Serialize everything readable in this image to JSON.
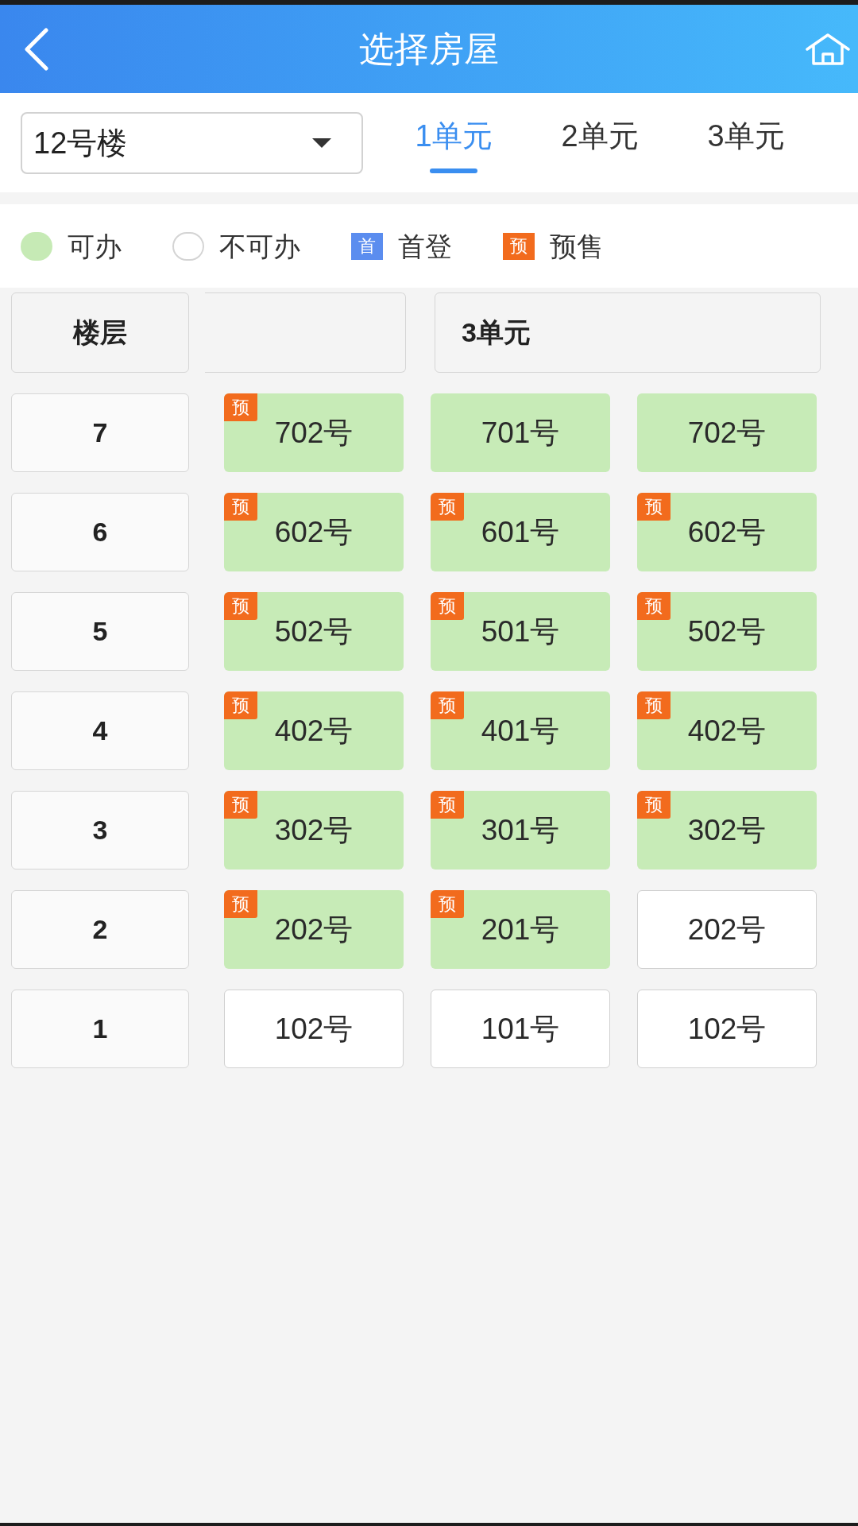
{
  "header": {
    "title": "选择房屋"
  },
  "building_select": {
    "value": "12号楼"
  },
  "unit_tabs": [
    {
      "label": "1单元",
      "selected": true
    },
    {
      "label": "2单元",
      "selected": false
    },
    {
      "label": "3单元",
      "selected": false
    }
  ],
  "legend": [
    {
      "kind": "dot",
      "color": "#c6eab5",
      "label": "可办"
    },
    {
      "kind": "ring",
      "label": "不可办"
    },
    {
      "kind": "tag",
      "tag": "首",
      "color": "#5b8def",
      "label": "首登"
    },
    {
      "kind": "tag",
      "tag": "预",
      "color": "#f26b1d",
      "label": "预售"
    }
  ],
  "table": {
    "columns": [
      {
        "kind": "floor",
        "label": "楼层"
      },
      {
        "kind": "blank"
      },
      {
        "kind": "unit",
        "label": "3单元"
      }
    ],
    "rows": [
      {
        "floor": "7",
        "rooms": [
          {
            "number": "702号",
            "available": true,
            "badge": "预"
          },
          {
            "number": "701号",
            "available": true
          },
          {
            "number": "702号",
            "available": true
          }
        ]
      },
      {
        "floor": "6",
        "rooms": [
          {
            "number": "602号",
            "available": true,
            "badge": "预"
          },
          {
            "number": "601号",
            "available": true,
            "badge": "预"
          },
          {
            "number": "602号",
            "available": true,
            "badge": "预"
          }
        ]
      },
      {
        "floor": "5",
        "rooms": [
          {
            "number": "502号",
            "available": true,
            "badge": "预"
          },
          {
            "number": "501号",
            "available": true,
            "badge": "预"
          },
          {
            "number": "502号",
            "available": true,
            "badge": "预"
          }
        ]
      },
      {
        "floor": "4",
        "rooms": [
          {
            "number": "402号",
            "available": true,
            "badge": "预"
          },
          {
            "number": "401号",
            "available": true,
            "badge": "预"
          },
          {
            "number": "402号",
            "available": true,
            "badge": "预"
          }
        ]
      },
      {
        "floor": "3",
        "rooms": [
          {
            "number": "302号",
            "available": true,
            "badge": "预"
          },
          {
            "number": "301号",
            "available": true,
            "badge": "预"
          },
          {
            "number": "302号",
            "available": true,
            "badge": "预"
          }
        ]
      },
      {
        "floor": "2",
        "rooms": [
          {
            "number": "202号",
            "available": true,
            "badge": "预"
          },
          {
            "number": "201号",
            "available": true,
            "badge": "预"
          },
          {
            "number": "202号",
            "available": false
          }
        ]
      },
      {
        "floor": "1",
        "rooms": [
          {
            "number": "102号",
            "available": false
          },
          {
            "number": "101号",
            "available": false
          },
          {
            "number": "102号",
            "available": false
          }
        ]
      }
    ]
  }
}
